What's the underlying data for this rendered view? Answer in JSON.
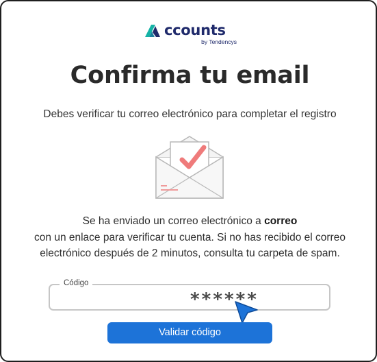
{
  "brand": {
    "name": "ccounts",
    "tagline": "by Tendencys",
    "mark_color": "#1aa8a0",
    "text_color": "#1f2a6b"
  },
  "title": "Confirma tu email",
  "subtitle": "Debes verificar tu correo electrónico para completar el registro",
  "illustration": {
    "icon": "envelope-check-icon",
    "check_color": "#ef7b7b"
  },
  "message": {
    "line1_prefix": "Se ha enviado un correo electrónico a ",
    "line1_bold": "correo",
    "line2": "con un enlace para verificar tu cuenta. Si no has recibido el correo",
    "line3": "electrónico después de 2 minutos, consulta tu carpeta de spam."
  },
  "code_field": {
    "label": "Código",
    "value": "******"
  },
  "validate_button": {
    "label": "Validar código",
    "color": "#1d73d8"
  },
  "cursor": {
    "icon": "mouse-pointer-icon",
    "color": "#1d73d8"
  }
}
